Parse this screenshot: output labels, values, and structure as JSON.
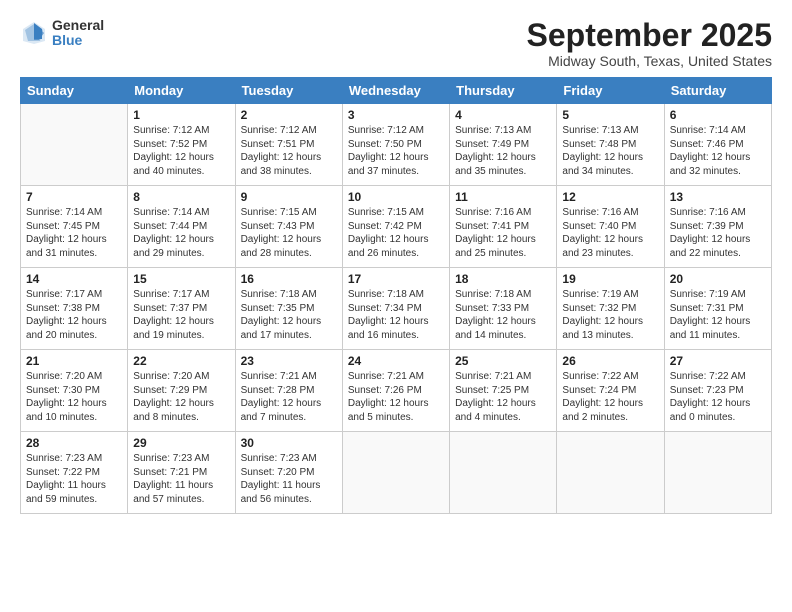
{
  "logo": {
    "general": "General",
    "blue": "Blue"
  },
  "title": "September 2025",
  "location": "Midway South, Texas, United States",
  "headers": [
    "Sunday",
    "Monday",
    "Tuesday",
    "Wednesday",
    "Thursday",
    "Friday",
    "Saturday"
  ],
  "weeks": [
    [
      {
        "day": "",
        "text": ""
      },
      {
        "day": "1",
        "text": "Sunrise: 7:12 AM\nSunset: 7:52 PM\nDaylight: 12 hours\nand 40 minutes."
      },
      {
        "day": "2",
        "text": "Sunrise: 7:12 AM\nSunset: 7:51 PM\nDaylight: 12 hours\nand 38 minutes."
      },
      {
        "day": "3",
        "text": "Sunrise: 7:12 AM\nSunset: 7:50 PM\nDaylight: 12 hours\nand 37 minutes."
      },
      {
        "day": "4",
        "text": "Sunrise: 7:13 AM\nSunset: 7:49 PM\nDaylight: 12 hours\nand 35 minutes."
      },
      {
        "day": "5",
        "text": "Sunrise: 7:13 AM\nSunset: 7:48 PM\nDaylight: 12 hours\nand 34 minutes."
      },
      {
        "day": "6",
        "text": "Sunrise: 7:14 AM\nSunset: 7:46 PM\nDaylight: 12 hours\nand 32 minutes."
      }
    ],
    [
      {
        "day": "7",
        "text": "Sunrise: 7:14 AM\nSunset: 7:45 PM\nDaylight: 12 hours\nand 31 minutes."
      },
      {
        "day": "8",
        "text": "Sunrise: 7:14 AM\nSunset: 7:44 PM\nDaylight: 12 hours\nand 29 minutes."
      },
      {
        "day": "9",
        "text": "Sunrise: 7:15 AM\nSunset: 7:43 PM\nDaylight: 12 hours\nand 28 minutes."
      },
      {
        "day": "10",
        "text": "Sunrise: 7:15 AM\nSunset: 7:42 PM\nDaylight: 12 hours\nand 26 minutes."
      },
      {
        "day": "11",
        "text": "Sunrise: 7:16 AM\nSunset: 7:41 PM\nDaylight: 12 hours\nand 25 minutes."
      },
      {
        "day": "12",
        "text": "Sunrise: 7:16 AM\nSunset: 7:40 PM\nDaylight: 12 hours\nand 23 minutes."
      },
      {
        "day": "13",
        "text": "Sunrise: 7:16 AM\nSunset: 7:39 PM\nDaylight: 12 hours\nand 22 minutes."
      }
    ],
    [
      {
        "day": "14",
        "text": "Sunrise: 7:17 AM\nSunset: 7:38 PM\nDaylight: 12 hours\nand 20 minutes."
      },
      {
        "day": "15",
        "text": "Sunrise: 7:17 AM\nSunset: 7:37 PM\nDaylight: 12 hours\nand 19 minutes."
      },
      {
        "day": "16",
        "text": "Sunrise: 7:18 AM\nSunset: 7:35 PM\nDaylight: 12 hours\nand 17 minutes."
      },
      {
        "day": "17",
        "text": "Sunrise: 7:18 AM\nSunset: 7:34 PM\nDaylight: 12 hours\nand 16 minutes."
      },
      {
        "day": "18",
        "text": "Sunrise: 7:18 AM\nSunset: 7:33 PM\nDaylight: 12 hours\nand 14 minutes."
      },
      {
        "day": "19",
        "text": "Sunrise: 7:19 AM\nSunset: 7:32 PM\nDaylight: 12 hours\nand 13 minutes."
      },
      {
        "day": "20",
        "text": "Sunrise: 7:19 AM\nSunset: 7:31 PM\nDaylight: 12 hours\nand 11 minutes."
      }
    ],
    [
      {
        "day": "21",
        "text": "Sunrise: 7:20 AM\nSunset: 7:30 PM\nDaylight: 12 hours\nand 10 minutes."
      },
      {
        "day": "22",
        "text": "Sunrise: 7:20 AM\nSunset: 7:29 PM\nDaylight: 12 hours\nand 8 minutes."
      },
      {
        "day": "23",
        "text": "Sunrise: 7:21 AM\nSunset: 7:28 PM\nDaylight: 12 hours\nand 7 minutes."
      },
      {
        "day": "24",
        "text": "Sunrise: 7:21 AM\nSunset: 7:26 PM\nDaylight: 12 hours\nand 5 minutes."
      },
      {
        "day": "25",
        "text": "Sunrise: 7:21 AM\nSunset: 7:25 PM\nDaylight: 12 hours\nand 4 minutes."
      },
      {
        "day": "26",
        "text": "Sunrise: 7:22 AM\nSunset: 7:24 PM\nDaylight: 12 hours\nand 2 minutes."
      },
      {
        "day": "27",
        "text": "Sunrise: 7:22 AM\nSunset: 7:23 PM\nDaylight: 12 hours\nand 0 minutes."
      }
    ],
    [
      {
        "day": "28",
        "text": "Sunrise: 7:23 AM\nSunset: 7:22 PM\nDaylight: 11 hours\nand 59 minutes."
      },
      {
        "day": "29",
        "text": "Sunrise: 7:23 AM\nSunset: 7:21 PM\nDaylight: 11 hours\nand 57 minutes."
      },
      {
        "day": "30",
        "text": "Sunrise: 7:23 AM\nSunset: 7:20 PM\nDaylight: 11 hours\nand 56 minutes."
      },
      {
        "day": "",
        "text": ""
      },
      {
        "day": "",
        "text": ""
      },
      {
        "day": "",
        "text": ""
      },
      {
        "day": "",
        "text": ""
      }
    ]
  ]
}
